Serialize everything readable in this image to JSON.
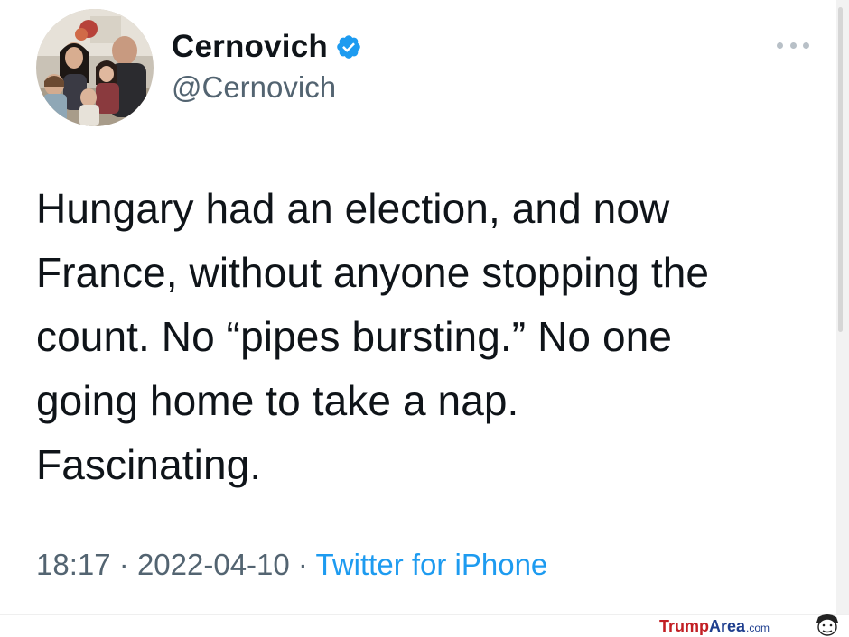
{
  "tweet": {
    "author": {
      "display_name": "Cernovich",
      "handle": "@Cernovich",
      "verified": true,
      "avatar_icon": "family-photo-avatar"
    },
    "more_icon": "more-options-icon",
    "text": "Hungary had an election, and now\nFrance, without anyone stopping the\ncount. No “pipes bursting.” No one\ngoing home to take a nap.\nFascinating.",
    "time": "18:17",
    "separator": "·",
    "date": "2022-04-10",
    "source": "Twitter for iPhone"
  },
  "watermark": {
    "part1": "Trump",
    "part2": "Area",
    "part3": ".com",
    "icon": "cartoon-face-logo"
  },
  "colors": {
    "text_primary": "#0f1419",
    "text_secondary": "#536471",
    "link_blue": "#1d9bf0",
    "verified_blue": "#1d9bf0",
    "watermark_red": "#c21f24",
    "watermark_blue": "#1f3f8f"
  }
}
